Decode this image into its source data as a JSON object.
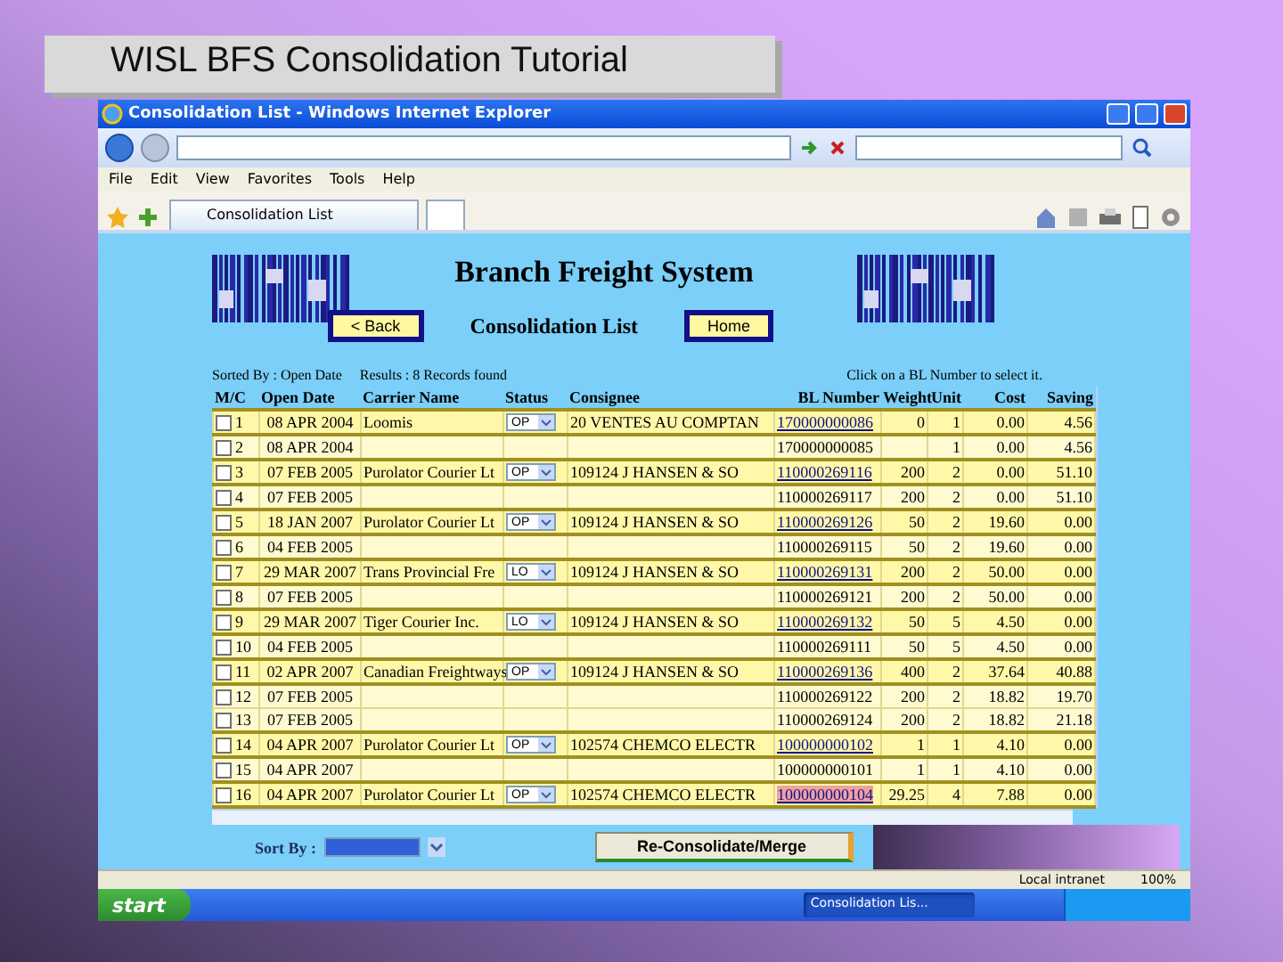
{
  "slide": {
    "title": "WISL BFS Consolidation Tutorial"
  },
  "browser": {
    "title": "Consolidation List - Windows Internet Explorer",
    "menu": [
      "File",
      "Edit",
      "View",
      "Favorites",
      "Tools",
      "Help"
    ],
    "tab": {
      "label": "Consolidation List",
      "selected": true
    },
    "status_bar": {
      "zone": "Local intranet",
      "zoom": "100%"
    }
  },
  "page": {
    "heading": "Branch Freight System",
    "subheading": "Consolidation List",
    "back_button": "< Back",
    "home_button": "Home",
    "sorted_by": "Sorted By : Open Date",
    "results": "Results : 8 Records found",
    "hint": "Click on a BL Number to select it.",
    "sort_label": "Sort By :",
    "merge_button": "Re-Consolidate/Merge"
  },
  "table": {
    "columns": [
      "M/C",
      "Open Date",
      "Carrier Name",
      "Status",
      "Consignee",
      "BL Number",
      "Weight",
      "Unit",
      "Cost",
      "Saving"
    ],
    "rows": [
      {
        "kind": "master",
        "number": "1",
        "checked": false,
        "open_date": "08 APR 2004",
        "carrier": "Loomis",
        "status": "OP",
        "consignee": "20 VENTES AU COMPTAN",
        "bl_number": "170000000086",
        "highlighted": false,
        "weight": "0",
        "unit": "1",
        "cost": "0.00",
        "saving": "4.56"
      },
      {
        "kind": "member",
        "number": "2",
        "checked": false,
        "open_date": "08 APR 2004",
        "bl_number": "170000000085",
        "highlighted": false,
        "unit": "1",
        "cost": "0.00",
        "saving": "4.56"
      },
      {
        "kind": "master",
        "number": "3",
        "checked": false,
        "open_date": "07 FEB 2005",
        "carrier": "Purolator Courier Lt",
        "status": "OP",
        "consignee": "109124 J HANSEN & SO",
        "bl_number": "110000269116",
        "highlighted": false,
        "weight": "200",
        "unit": "2",
        "cost": "0.00",
        "saving": "51.10"
      },
      {
        "kind": "member",
        "number": "4",
        "checked": false,
        "open_date": "07 FEB 2005",
        "bl_number": "110000269117",
        "highlighted": false,
        "weight": "200",
        "unit": "2",
        "cost": "0.00",
        "saving": "51.10"
      },
      {
        "kind": "master",
        "number": "5",
        "checked": false,
        "open_date": "18 JAN 2007",
        "carrier": "Purolator Courier Lt",
        "status": "OP",
        "consignee": "109124 J HANSEN & SO",
        "bl_number": "110000269126",
        "highlighted": false,
        "weight": "50",
        "unit": "2",
        "cost": "19.60",
        "saving": "0.00"
      },
      {
        "kind": "member",
        "number": "6",
        "checked": false,
        "open_date": "04 FEB 2005",
        "bl_number": "110000269115",
        "highlighted": false,
        "weight": "50",
        "unit": "2",
        "cost": "19.60",
        "saving": "0.00"
      },
      {
        "kind": "master",
        "number": "7",
        "checked": false,
        "open_date": "29 MAR 2007",
        "carrier": "Trans Provincial Fre",
        "status": "LO",
        "consignee": "109124 J HANSEN & SO",
        "bl_number": "110000269131",
        "highlighted": false,
        "weight": "200",
        "unit": "2",
        "cost": "50.00",
        "saving": "0.00"
      },
      {
        "kind": "member",
        "number": "8",
        "checked": false,
        "open_date": "07 FEB 2005",
        "bl_number": "110000269121",
        "highlighted": false,
        "weight": "200",
        "unit": "2",
        "cost": "50.00",
        "saving": "0.00"
      },
      {
        "kind": "master",
        "number": "9",
        "checked": false,
        "open_date": "29 MAR 2007",
        "carrier": "Tiger Courier Inc.",
        "status": "LO",
        "consignee": "109124 J HANSEN & SO",
        "bl_number": "110000269132",
        "highlighted": false,
        "weight": "50",
        "unit": "5",
        "cost": "4.50",
        "saving": "0.00"
      },
      {
        "kind": "member",
        "number": "10",
        "checked": false,
        "open_date": "04 FEB 2005",
        "bl_number": "110000269111",
        "highlighted": false,
        "weight": "50",
        "unit": "5",
        "cost": "4.50",
        "saving": "0.00"
      },
      {
        "kind": "master",
        "number": "11",
        "checked": false,
        "open_date": "02 APR 2007",
        "carrier": "Canadian Freightways",
        "status": "OP",
        "consignee": "109124 J HANSEN & SO",
        "bl_number": "110000269136",
        "highlighted": false,
        "weight": "400",
        "unit": "2",
        "cost": "37.64",
        "saving": "40.88"
      },
      {
        "kind": "member",
        "number": "12",
        "checked": false,
        "open_date": "07 FEB 2005",
        "bl_number": "110000269122",
        "highlighted": false,
        "weight": "200",
        "unit": "2",
        "cost": "18.82",
        "saving": "19.70"
      },
      {
        "kind": "member",
        "number": "13",
        "checked": false,
        "open_date": "07 FEB 2005",
        "bl_number": "110000269124",
        "highlighted": false,
        "weight": "200",
        "unit": "2",
        "cost": "18.82",
        "saving": "21.18"
      },
      {
        "kind": "master",
        "number": "14",
        "checked": false,
        "open_date": "04 APR 2007",
        "carrier": "Purolator Courier Lt",
        "status": "OP",
        "consignee": "102574 CHEMCO ELECTR",
        "bl_number": "100000000102",
        "highlighted": false,
        "weight": "1",
        "unit": "1",
        "cost": "4.10",
        "saving": "0.00"
      },
      {
        "kind": "member",
        "number": "15",
        "checked": false,
        "open_date": "04 APR 2007",
        "bl_number": "100000000101",
        "highlighted": false,
        "weight": "1",
        "unit": "1",
        "cost": "4.10",
        "saving": "0.00"
      },
      {
        "kind": "master",
        "number": "16",
        "checked": false,
        "open_date": "04 APR 2007",
        "carrier": "Purolator Courier Lt",
        "status": "OP",
        "consignee": "102574 CHEMCO ELECTR",
        "bl_number": "100000000104",
        "highlighted": true,
        "weight": "29.25",
        "unit": "4",
        "cost": "7.88",
        "saving": "0.00"
      }
    ]
  },
  "taskbar": {
    "start": "start",
    "items": [
      {
        "label": "Consolidation Lis...",
        "selected": true
      }
    ]
  }
}
